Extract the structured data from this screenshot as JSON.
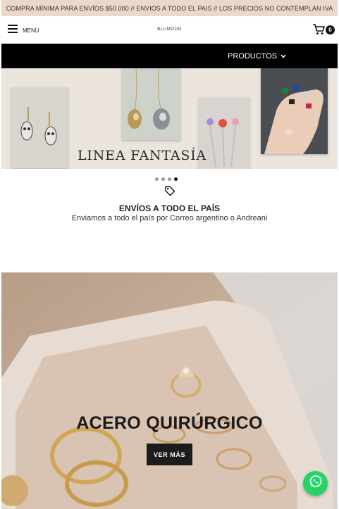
{
  "announcement": "COMPRA MÍNIMA PARA ENVÍOS $50.000 // ENVIOS A TODO EL PAIS // LOS PRECIOS NO CONTEMPLAN IVA",
  "header": {
    "menu_label": "MENÚ",
    "logo_text": "BLUMOON",
    "cart_count": "0"
  },
  "nav": {
    "products_label": "PRODUCTOS"
  },
  "hero": {
    "slide_title": "LINEA FANTASÍA",
    "slides_total": 4,
    "active_slide": 4
  },
  "shipping": {
    "title": "ENVÍOS A TODO EL PAÍS",
    "subtitle": "Enviamos a todo el país por Correo argentino o Andreani"
  },
  "banner": {
    "title": "ACERO QUIRÚRGICO",
    "button_label": "VER MÁS"
  },
  "icons": {
    "menu": "hamburger-icon",
    "cart": "cart-icon",
    "dropdown": "chevron-down-icon",
    "shipping": "tag-icon",
    "chat": "whatsapp-icon"
  },
  "colors": {
    "announce_bg": "#ead9c9",
    "nav_bg": "#000000",
    "whatsapp": "#25d366"
  }
}
